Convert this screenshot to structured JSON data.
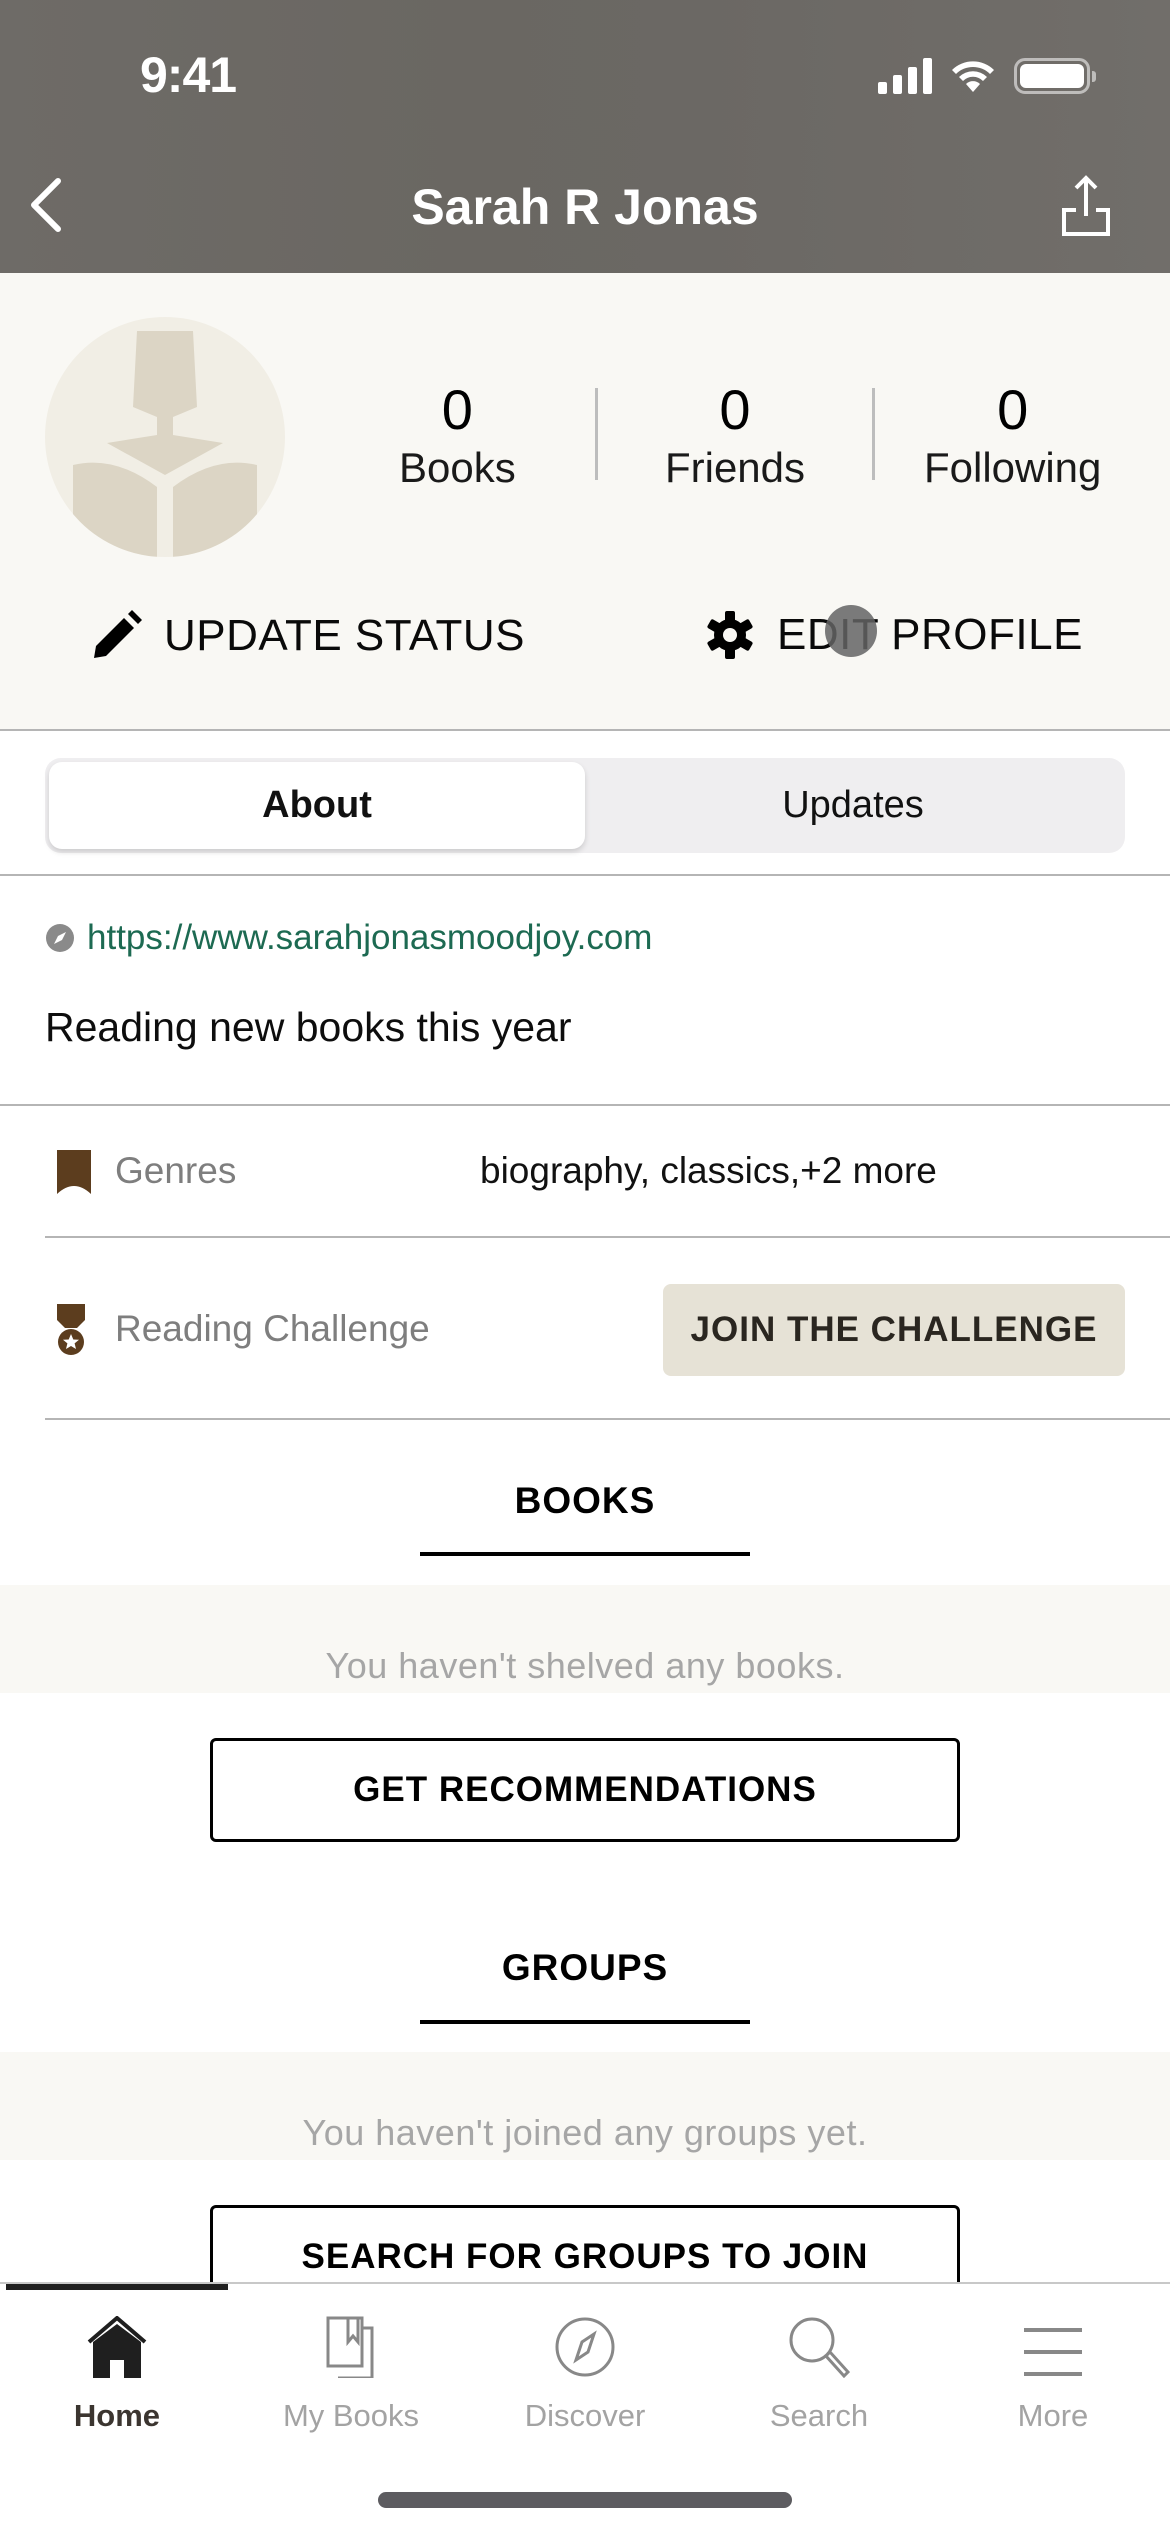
{
  "status_bar": {
    "time": "9:41"
  },
  "nav": {
    "title": "Sarah R Jonas",
    "back_icon": "chevron-left-icon",
    "share_icon": "share-icon"
  },
  "profile": {
    "stats": [
      {
        "value": "0",
        "label": "Books"
      },
      {
        "value": "0",
        "label": "Friends"
      },
      {
        "value": "0",
        "label": "Following"
      }
    ],
    "update_status_label": "UPDATE STATUS",
    "edit_profile_label": "EDIT PROFILE"
  },
  "segments": {
    "tabs": [
      {
        "label": "About",
        "active": true
      },
      {
        "label": "Updates",
        "active": false
      }
    ]
  },
  "about": {
    "website": "https://www.sarahjonasmoodjoy.com",
    "bio": "Reading new books this year",
    "genres_label": "Genres",
    "genres_value": "biography, classics,+2 more",
    "challenge_label": "Reading Challenge",
    "join_challenge_label": "JOIN THE CHALLENGE"
  },
  "books_section": {
    "title": "BOOKS",
    "empty_text": "You haven't shelved any books.",
    "button_label": "GET RECOMMENDATIONS"
  },
  "groups_section": {
    "title": "GROUPS",
    "empty_text": "You haven't joined any groups yet.",
    "button_label": "SEARCH FOR GROUPS TO JOIN"
  },
  "tabbar": {
    "items": [
      {
        "label": "Home",
        "icon": "home-icon",
        "active": true
      },
      {
        "label": "My Books",
        "icon": "my-books-icon",
        "active": false
      },
      {
        "label": "Discover",
        "icon": "compass-icon",
        "active": false
      },
      {
        "label": "Search",
        "icon": "search-icon",
        "active": false
      },
      {
        "label": "More",
        "icon": "menu-icon",
        "active": false
      }
    ]
  },
  "colors": {
    "link": "#1d6a52",
    "accent_brown": "#5c3d1e",
    "cream": "#f9f8f4",
    "join_button_bg": "#e6e2d6"
  }
}
